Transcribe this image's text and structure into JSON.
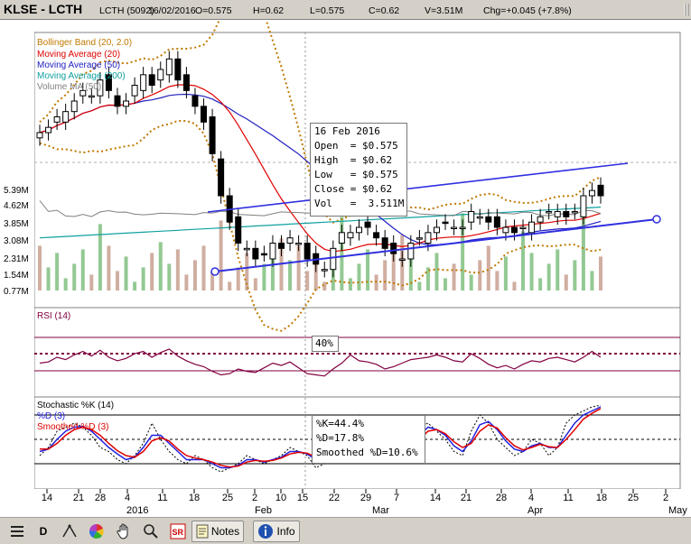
{
  "header": {
    "exchange": "KLSE - LCTH",
    "symbol_code": "LCTH (5092)",
    "date": "16/02/2016",
    "open": "O=0.575",
    "high": "H=0.62",
    "low": "L=0.575",
    "close": "C=0.62",
    "volume": "V=3.51M",
    "change": "Chg=+0.045 (+7.8%)"
  },
  "legend": {
    "bollinger": "Bollinger Band (20, 2.0)",
    "ma20": "Moving Average (20)",
    "ma50": "Moving Average (50)",
    "ma200": "Moving Average (200)",
    "volma": "Volume MA (50)"
  },
  "rsi_panel": {
    "label": "RSI (14)",
    "readout": "40%"
  },
  "stoch_panel": {
    "label_k": "Stochastic %K (14)",
    "label_d": "%D (3)",
    "label_sd": "Smoothed %D (3)"
  },
  "tooltip_price": {
    "date": "16 Feb 2016",
    "open": "Open  = $0.575",
    "high": "High  = $0.62",
    "low": "Low   = $0.575",
    "close": "Close = $0.62",
    "vol": "Vol   =  3.511M"
  },
  "tooltip_stoch": {
    "k": "%K=44.4%",
    "d": "%D=17.8%",
    "sd": "Smoothed %D=10.6%"
  },
  "toolbar": {
    "period": "D",
    "notes": "Notes",
    "info": "Info"
  },
  "colors": {
    "bollinger": "#c07800",
    "ma20": "#e00000",
    "ma50": "#2020c0",
    "ma200": "#10a0a0",
    "volma": "#808080",
    "rsi": "#800040",
    "volume_down": "#c8a090",
    "volume_up": "#80c080",
    "trendline": "#3030e0"
  },
  "chart_data": [
    {
      "type": "candlestick",
      "yticks": [
        "5.39M",
        "4.62M",
        "3.85M",
        "3.08M",
        "2.31M",
        "1.54M",
        "0.77M"
      ],
      "x_tick_labels": [
        "14",
        "21",
        "28",
        "4",
        "11",
        "18",
        "25",
        "2",
        "10",
        "15",
        "22",
        "29",
        "7",
        "14",
        "21",
        "28",
        "4",
        "11",
        "18",
        "25",
        "2"
      ],
      "x_month_labels": [
        "2016",
        "Feb",
        "Mar",
        "Apr",
        "May"
      ],
      "close": [
        0.52,
        0.53,
        0.55,
        0.56,
        0.58,
        0.6,
        0.59,
        0.62,
        0.6,
        0.57,
        0.58,
        0.61,
        0.63,
        0.61,
        0.64,
        0.66,
        0.62,
        0.6,
        0.57,
        0.54,
        0.48,
        0.4,
        0.35,
        0.31,
        0.3,
        0.28,
        0.29,
        0.31,
        0.3,
        0.32,
        0.31,
        0.28,
        0.27,
        0.26,
        0.3,
        0.33,
        0.33,
        0.34,
        0.34,
        0.32,
        0.3,
        0.29,
        0.28,
        0.31,
        0.32,
        0.33,
        0.34,
        0.35,
        0.34,
        0.34,
        0.37,
        0.36,
        0.35,
        0.34,
        0.34,
        0.33,
        0.34,
        0.35,
        0.36,
        0.37,
        0.37,
        0.36,
        0.37,
        0.4,
        0.41,
        0.4
      ]
    },
    {
      "type": "line",
      "name": "RSI (14)",
      "values": [
        45,
        46,
        50,
        48,
        52,
        55,
        51,
        56,
        50,
        47,
        49,
        53,
        55,
        50,
        54,
        57,
        51,
        47,
        44,
        42,
        38,
        35,
        36,
        40,
        38,
        37,
        41,
        45,
        43,
        46,
        41,
        36,
        35,
        34,
        40,
        45,
        52,
        47,
        46,
        44,
        40,
        42,
        45,
        48,
        49,
        50,
        52,
        50,
        47,
        46,
        53,
        49,
        44,
        41,
        43,
        40,
        44,
        47,
        46,
        49,
        50,
        48,
        46,
        50,
        55,
        50
      ]
    },
    {
      "type": "line",
      "name": "Stochastic",
      "series": [
        {
          "name": "%K",
          "values": [
            30,
            40,
            60,
            65,
            70,
            65,
            55,
            40,
            35,
            25,
            20,
            30,
            45,
            70,
            50,
            35,
            25,
            20,
            30,
            25,
            15,
            10,
            15,
            20,
            30,
            25,
            20,
            25,
            30,
            40,
            35,
            30,
            15,
            20,
            25,
            40,
            60,
            80,
            70,
            55,
            40,
            30,
            35,
            50,
            65,
            70,
            60,
            50,
            35,
            30,
            60,
            80,
            70,
            50,
            40,
            30,
            35,
            50,
            45,
            30,
            40,
            70,
            80,
            85,
            90,
            92
          ]
        },
        {
          "name": "%D",
          "values": [
            35,
            38,
            50,
            60,
            65,
            66,
            60,
            50,
            40,
            32,
            25,
            28,
            40,
            55,
            55,
            45,
            35,
            25,
            25,
            25,
            20,
            15,
            15,
            18,
            25,
            25,
            22,
            25,
            28,
            35,
            35,
            32,
            25,
            22,
            22,
            32,
            48,
            68,
            72,
            65,
            50,
            38,
            35,
            42,
            55,
            65,
            62,
            55,
            42,
            35,
            48,
            68,
            72,
            62,
            48,
            38,
            35,
            42,
            45,
            40,
            40,
            55,
            70,
            80,
            85,
            90
          ]
        },
        {
          "name": "Smoothed %D",
          "values": [
            38,
            38,
            45,
            55,
            62,
            65,
            62,
            55,
            45,
            36,
            30,
            28,
            35,
            48,
            52,
            48,
            38,
            30,
            27,
            25,
            22,
            18,
            16,
            17,
            22,
            24,
            23,
            24,
            27,
            32,
            34,
            33,
            28,
            24,
            22,
            28,
            40,
            58,
            68,
            66,
            55,
            43,
            37,
            40,
            50,
            60,
            62,
            57,
            47,
            40,
            45,
            60,
            68,
            64,
            52,
            42,
            37,
            40,
            44,
            41,
            40,
            50,
            62,
            75,
            82,
            88
          ]
        }
      ]
    }
  ]
}
